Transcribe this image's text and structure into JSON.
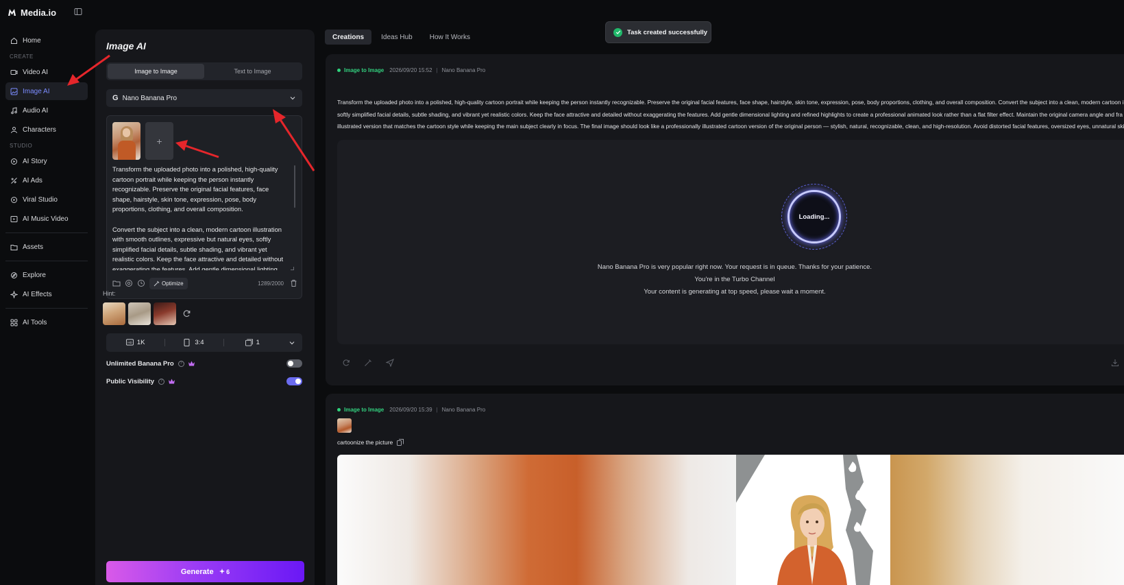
{
  "app": {
    "name": "Media.io"
  },
  "sidebar": {
    "home": "Home",
    "section_create": "CREATE",
    "create_items": [
      "Video AI",
      "Image AI",
      "Audio AI",
      "Characters"
    ],
    "section_studio": "STUDIO",
    "studio_items": [
      "AI Story",
      "AI Ads",
      "Viral Studio",
      "AI Music Video"
    ],
    "assets": "Assets",
    "explore_items": [
      "Explore",
      "AI Effects"
    ],
    "tools": "AI Tools",
    "active_item": "Image AI"
  },
  "panel": {
    "title": "Image AI",
    "mode_tabs": [
      "Image to Image",
      "Text to Image"
    ],
    "active_mode": "Image to Image",
    "model": "Nano Banana Pro",
    "add_image_label": "+",
    "prompt": "Transform the uploaded photo into a polished, high-quality cartoon portrait while keeping the person instantly recognizable. Preserve the original facial features, face shape, hairstyle, skin tone, expression, pose, body proportions, clothing, and overall composition.\n\nConvert the subject into a clean, modern cartoon illustration with smooth outlines, expressive but natural eyes, softly simplified facial details, subtle shading, and vibrant yet realistic colors. Keep the face attractive and detailed without exaggerating the features. Add gentle dimensional lighting",
    "optimize_label": "Optimize",
    "char_count": "1289/2000",
    "hint_label": "Hint:",
    "settings": {
      "resolution": "1K",
      "ratio": "3:4",
      "count": "1"
    },
    "unlimited_label": "Unlimited Banana Pro",
    "unlimited_on": false,
    "public_label": "Public Visibility",
    "public_on": true,
    "generate_label": "Generate",
    "generate_cost": "6"
  },
  "top_tabs": [
    "Creations",
    "Ideas Hub",
    "How It Works"
  ],
  "active_tab": "Creations",
  "toast": "Task created successfully",
  "task1": {
    "type": "Image to Image",
    "date": "2026/09/20 15:52",
    "model": "Nano Banana Pro",
    "prompt_lines": [
      "Transform the uploaded photo into a polished, high-quality cartoon portrait while keeping the person instantly recognizable. Preserve the original facial features, face shape, hairstyle, skin tone, expression, pose, body proportions, clothing, and overall composition. Convert the subject into a clean, modern cartoon ill",
      "softly simplified facial details, subtle shading, and vibrant yet realistic colors. Keep the face attractive and detailed without exaggerating the features. Add gentle dimensional lighting and refined highlights to create a professional animated look rather than a flat filter effect. Maintain the original camera angle and fra",
      "illustrated version that matches the cartoon style while keeping the main subject clearly in focus. The final image should look like a professionally illustrated cartoon version of the original person — stylish, natural, recognizable, clean, and high-resolution. Avoid distorted facial features, oversized eyes, unnatural skin t"
    ],
    "loading": "Loading...",
    "msg1": "Nano Banana Pro is very popular right now. Your request is in queue. Thanks for your patience.",
    "msg2": "You're in the Turbo Channel",
    "msg3": "Your content is generating at top speed, please wait a moment."
  },
  "task2": {
    "type": "Image to Image",
    "date": "2026/09/20 15:39",
    "model": "Nano Banana Pro",
    "prompt": "cartoonize the picture"
  },
  "colors": {
    "accent": "#7c8cff",
    "success": "#33d17f",
    "generate_from": "#d95ae8",
    "generate_to": "#6a18f5",
    "annotation_arrow": "#e5262b"
  }
}
